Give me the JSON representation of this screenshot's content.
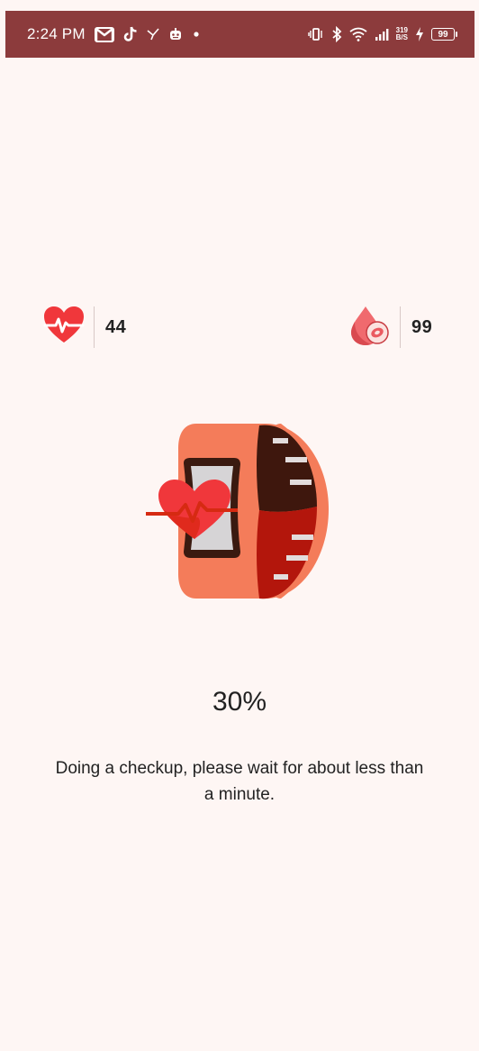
{
  "status_bar": {
    "time": "2:24 PM",
    "net_speed_value": "319",
    "net_speed_unit": "B/S",
    "battery": "99",
    "background_color": "#8c3b3c",
    "left_icons": [
      "gmail-icon",
      "tiktok-icon",
      "navigation-icon",
      "bot-icon",
      "dot-icon"
    ],
    "right_icons": [
      "vibrate-icon",
      "bluetooth-icon",
      "wifi-icon",
      "signal-icon",
      "net-speed",
      "charging-icon",
      "battery-icon"
    ]
  },
  "metrics": {
    "heart_rate": {
      "value": "44",
      "icon": "heart-rate-icon"
    },
    "blood_oxygen": {
      "value": "99",
      "icon": "blood-drop-icon"
    }
  },
  "illustration": {
    "icon": "smart-band-heart-icon"
  },
  "progress": {
    "percent_label": "30%",
    "value": 0.3
  },
  "message": "Doing a checkup, please wait for about less than a minute.",
  "colors": {
    "page_background": "#fef6f4",
    "heart": "#f0373b",
    "band_orange": "#f47c5a",
    "band_dark": "#3e170d",
    "band_red": "#b3160c"
  }
}
